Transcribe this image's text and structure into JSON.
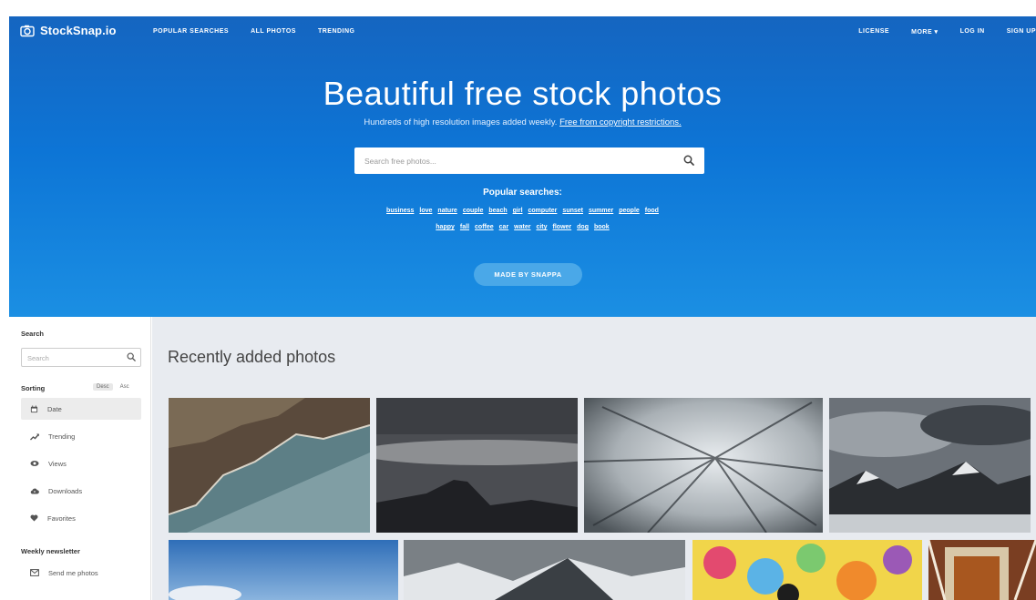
{
  "brand": {
    "name": "StockSnap.io"
  },
  "nav": {
    "left": [
      "POPULAR SEARCHES",
      "ALL PHOTOS",
      "TRENDING"
    ],
    "right": [
      "LICENSE",
      "MORE ▾",
      "LOG IN",
      "SIGN UP"
    ]
  },
  "hero": {
    "title": "Beautiful free stock photos",
    "subtitle": "Hundreds of high resolution images added weekly.",
    "subtitle_link": "Free from copyright restrictions.",
    "search_placeholder": "Search free photos...",
    "popular_title": "Popular searches:",
    "tags_row1": [
      "business",
      "love",
      "nature",
      "couple",
      "beach",
      "girl",
      "computer",
      "sunset",
      "summer",
      "people",
      "food"
    ],
    "tags_row2": [
      "happy",
      "fall",
      "coffee",
      "car",
      "water",
      "city",
      "flower",
      "dog",
      "book"
    ],
    "cta": "MADE BY SNAPPA"
  },
  "sidebar": {
    "search_heading": "Search",
    "search_placeholder": "Search",
    "sorting_heading": "Sorting",
    "sort_desc": "Desc",
    "sort_asc": "Asc",
    "sort_items": [
      {
        "label": "Date",
        "icon": "calendar-icon",
        "active": true
      },
      {
        "label": "Trending",
        "icon": "trending-icon",
        "active": false
      },
      {
        "label": "Views",
        "icon": "eye-icon",
        "active": false
      },
      {
        "label": "Downloads",
        "icon": "cloud-download-icon",
        "active": false
      },
      {
        "label": "Favorites",
        "icon": "heart-icon",
        "active": false
      }
    ],
    "newsletter_heading": "Weekly newsletter",
    "newsletter_item": "Send me photos",
    "newsletter_icon": "mail-icon"
  },
  "main": {
    "title": "Recently added photos"
  },
  "colors": {
    "hero_top": "#1565c0",
    "hero_bottom": "#1b8fe3",
    "cta": "#4aa8e8",
    "main_bg": "#e8ebf0"
  }
}
